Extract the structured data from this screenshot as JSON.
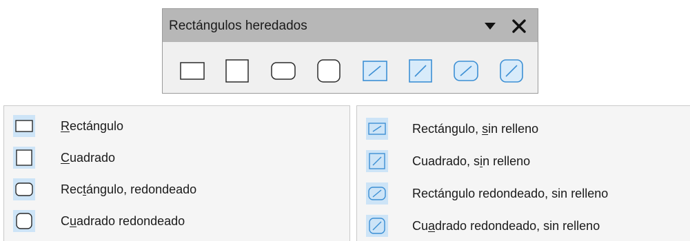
{
  "toolbar": {
    "title": "Rectángulos heredados",
    "dropdown_icon": "triangle-down-icon",
    "close_icon": "close-icon",
    "buttons": [
      {
        "name": "rectangle-button",
        "icon": "rectangle-icon"
      },
      {
        "name": "square-button",
        "icon": "square-icon"
      },
      {
        "name": "rounded-rectangle-button",
        "icon": "rounded-rectangle-icon"
      },
      {
        "name": "rounded-square-button",
        "icon": "rounded-square-icon"
      },
      {
        "name": "rectangle-unfilled-button",
        "icon": "rectangle-unfilled-icon"
      },
      {
        "name": "square-unfilled-button",
        "icon": "square-unfilled-icon"
      },
      {
        "name": "rounded-rectangle-unfilled-button",
        "icon": "rounded-rectangle-unfilled-icon"
      },
      {
        "name": "rounded-square-unfilled-button",
        "icon": "rounded-square-unfilled-icon"
      }
    ]
  },
  "menu_left": {
    "items": [
      {
        "pre": "",
        "mnemonic": "R",
        "post": "ectángulo",
        "icon": "rectangle-icon"
      },
      {
        "pre": "",
        "mnemonic": "C",
        "post": "uadrado",
        "icon": "square-icon"
      },
      {
        "pre": "Rec",
        "mnemonic": "t",
        "post": "ángulo, redondeado",
        "icon": "rounded-rectangle-icon"
      },
      {
        "pre": "C",
        "mnemonic": "u",
        "post": "adrado redondeado",
        "icon": "rounded-square-icon"
      }
    ]
  },
  "menu_right": {
    "items": [
      {
        "pre": "Rectángulo, ",
        "mnemonic": "s",
        "post": "in relleno",
        "icon": "rectangle-unfilled-icon"
      },
      {
        "pre": "Cuadrado, s",
        "mnemonic": "i",
        "post": "n relleno",
        "icon": "square-unfilled-icon"
      },
      {
        "pre": "Rectán",
        "mnemonic": "g",
        "post": "ulo redondeado, sin relleno",
        "icon": "rounded-rectangle-unfilled-icon"
      },
      {
        "pre": "Cu",
        "mnemonic": "a",
        "post": "drado redondeado, sin relleno",
        "icon": "rounded-square-unfilled-icon"
      }
    ]
  },
  "colors": {
    "titlebar": "#b7b7b7",
    "toolbar_bg": "#f0f0f0",
    "icon_highlight": "#cde4f7",
    "unfilled_shape": "#3c8fd4",
    "shape_outline": "#2a2a2a"
  }
}
